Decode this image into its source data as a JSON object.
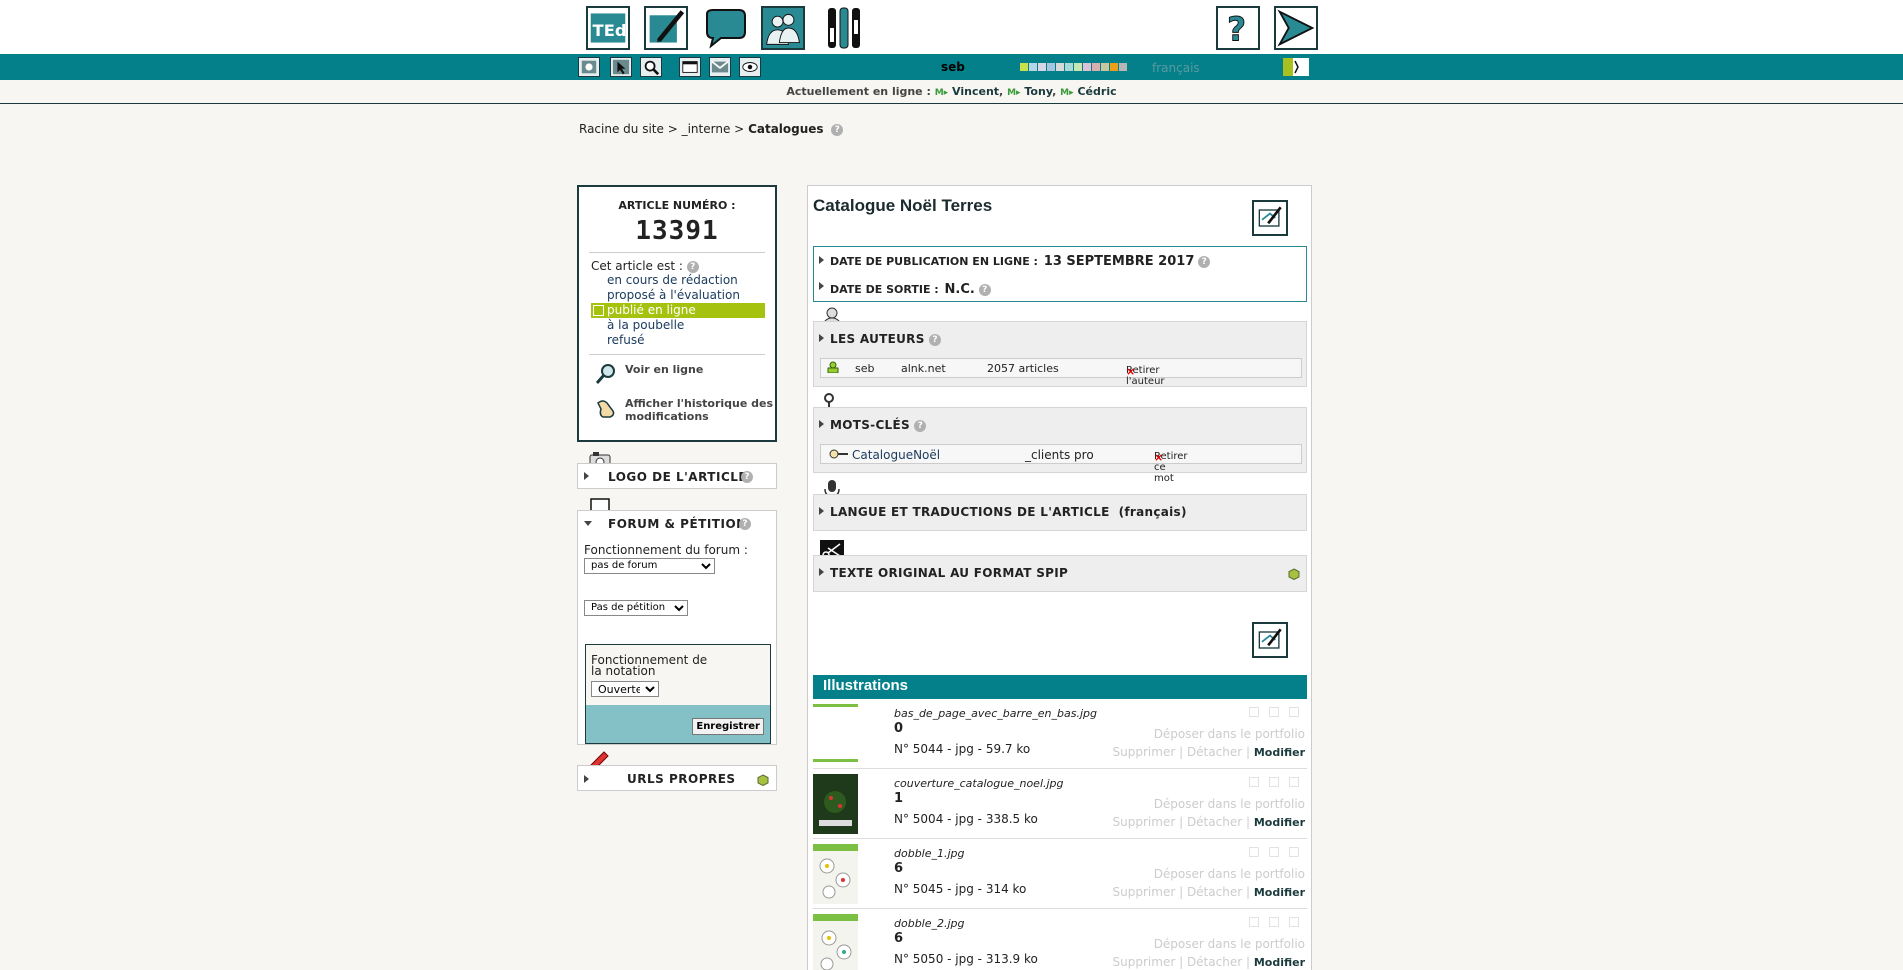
{
  "topbar": {
    "left_icons": [
      "ted-logo-icon",
      "pen-edit-icon",
      "forum-bubble-icon",
      "users-icon",
      "tools-icon"
    ],
    "logo_text": "TEd",
    "right_icons": [
      "help-question-icon",
      "exit-arrow-icon"
    ]
  },
  "toolbar": {
    "user": "seb",
    "language": "français",
    "swatches": [
      "#c8e04a",
      "#b4d6e6",
      "#d6d6e6",
      "#a6c6e0",
      "#d8d8d8",
      "#a8d8d8",
      "#c6e6b4",
      "#e0c0d6",
      "#d6b0b0",
      "#c6c6a0",
      "#eaa01a",
      "#b6b6b6"
    ]
  },
  "online": {
    "label": "Actuellement en ligne :",
    "users": [
      "Vincent",
      "Tony",
      "Cédric"
    ],
    "marker": "M▸"
  },
  "breadcrumb": {
    "root": "Racine du site",
    "sep": ">",
    "section": "_interne",
    "current": "Catalogues",
    "help": "?"
  },
  "article": {
    "number_label": "ARTICLE NUMÉRO :",
    "number": "13391",
    "status_label": "Cet article est :",
    "statuses": [
      "en cours de rédaction",
      "proposé à l'évaluation",
      "publié en ligne",
      "à la poubelle",
      "refusé"
    ],
    "active_status_index": 2,
    "view_online": "Voir en ligne",
    "history": "Afficher l'historique des modifications"
  },
  "sidebar": {
    "logo_title": "LOGO DE L'ARTICLE",
    "forum_title": "FORUM & PÉTITION",
    "forum_label": "Fonctionnement du forum :",
    "forum_value": "pas de forum",
    "petition_value": "Pas de pétition",
    "notation_label": "Fonctionnement de la notation",
    "notation_value": "Ouverte",
    "save": "Enregistrer",
    "urls_title": "URLS PROPRES"
  },
  "main": {
    "title": "Catalogue Noël Terres",
    "pub_date_label": "DATE DE PUBLICATION EN LIGNE :",
    "pub_date_value": "13 SEPTEMBRE 2017",
    "exit_date_label": "DATE DE SORTIE :",
    "exit_date_value": "N.C.",
    "authors_title": "LES AUTEURS",
    "author": {
      "name": "seb",
      "site": "alnk.net",
      "articles": "2057 articles",
      "remove": "Retirer l'auteur"
    },
    "keywords_title": "MOTS-CLÉS",
    "keyword": {
      "name": "CatalogueNoël",
      "group": "_clients pro",
      "remove": "Retirer ce mot"
    },
    "lang_title": "LANGUE ET TRADUCTIONS DE L'ARTICLE",
    "lang_value": "(français)",
    "original_title": "TEXTE ORIGINAL AU FORMAT SPIP",
    "x": "×"
  },
  "illustrations": {
    "title": "Illustrations",
    "deposer": "Déposer dans le portfolio",
    "supprimer": "Supprimer",
    "detacher": "Détacher",
    "modifier": "Modifier",
    "items": [
      {
        "file": "bas_de_page_avec_barre_en_bas.jpg",
        "rank": "0",
        "info": "N° 5044 - jpg - 59.7 ko"
      },
      {
        "file": "couverture_catalogue_noel.jpg",
        "rank": "1",
        "info": "N° 5004 - jpg - 338.5 ko"
      },
      {
        "file": "dobble_1.jpg",
        "rank": "6",
        "info": "N° 5045 - jpg - 314 ko"
      },
      {
        "file": "dobble_2.jpg",
        "rank": "6",
        "info": "N° 5050 - jpg - 313.9 ko"
      }
    ]
  }
}
